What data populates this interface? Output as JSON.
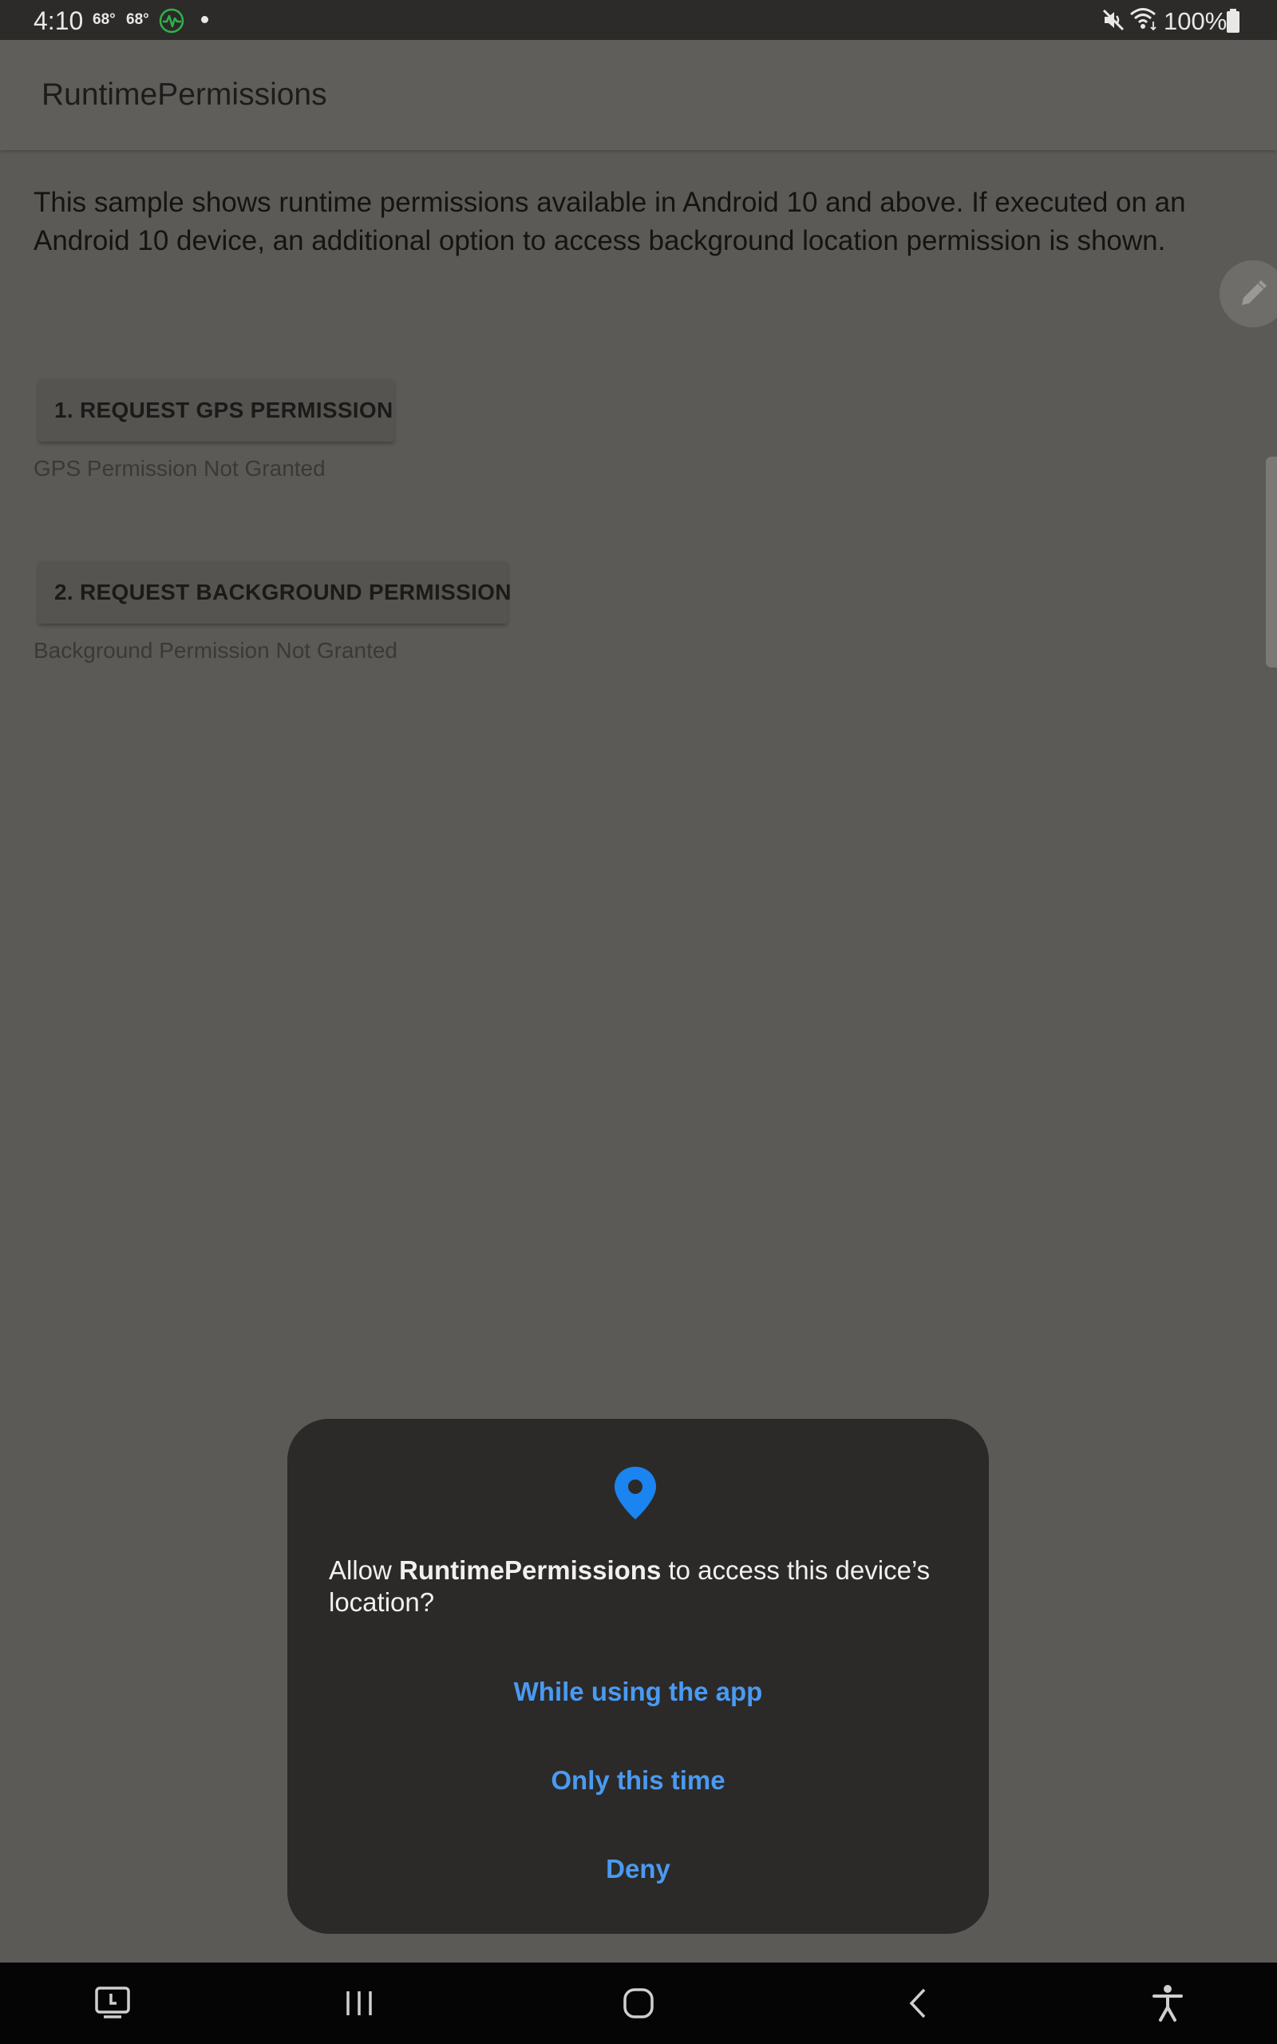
{
  "status_bar": {
    "time": "4:10",
    "temp1": "68°",
    "temp2": "68°",
    "battery": "100%",
    "icons": [
      "activity-app-icon",
      "notification-dot",
      "mute-icon",
      "wifi-icon",
      "battery-icon"
    ]
  },
  "app_bar": {
    "title": "RuntimePermissions"
  },
  "content": {
    "description": "This sample shows runtime permissions available in Android 10 and above. If executed on an Android 10 device, an additional option to access background location permission is shown.",
    "gps_button": "1. REQUEST GPS PERMISSION",
    "gps_status": "GPS Permission Not Granted",
    "background_button": "2. REQUEST BACKGROUND PERMISSION",
    "background_status": "Background Permission Not Granted",
    "fab_icon": "edit-icon"
  },
  "dialog": {
    "icon": "location-pin-icon",
    "message_prefix": "Allow ",
    "app_name": "RuntimePermissions",
    "message_suffix": " to access this device’s location?",
    "option_while_using": "While using the app",
    "option_only_this_time": "Only this time",
    "option_deny": "Deny",
    "accent_color": "#4a9af2"
  },
  "nav_bar": {
    "buttons": [
      "recent-apps-icon",
      "recents-icon",
      "home-icon",
      "back-icon",
      "accessibility-icon"
    ]
  }
}
